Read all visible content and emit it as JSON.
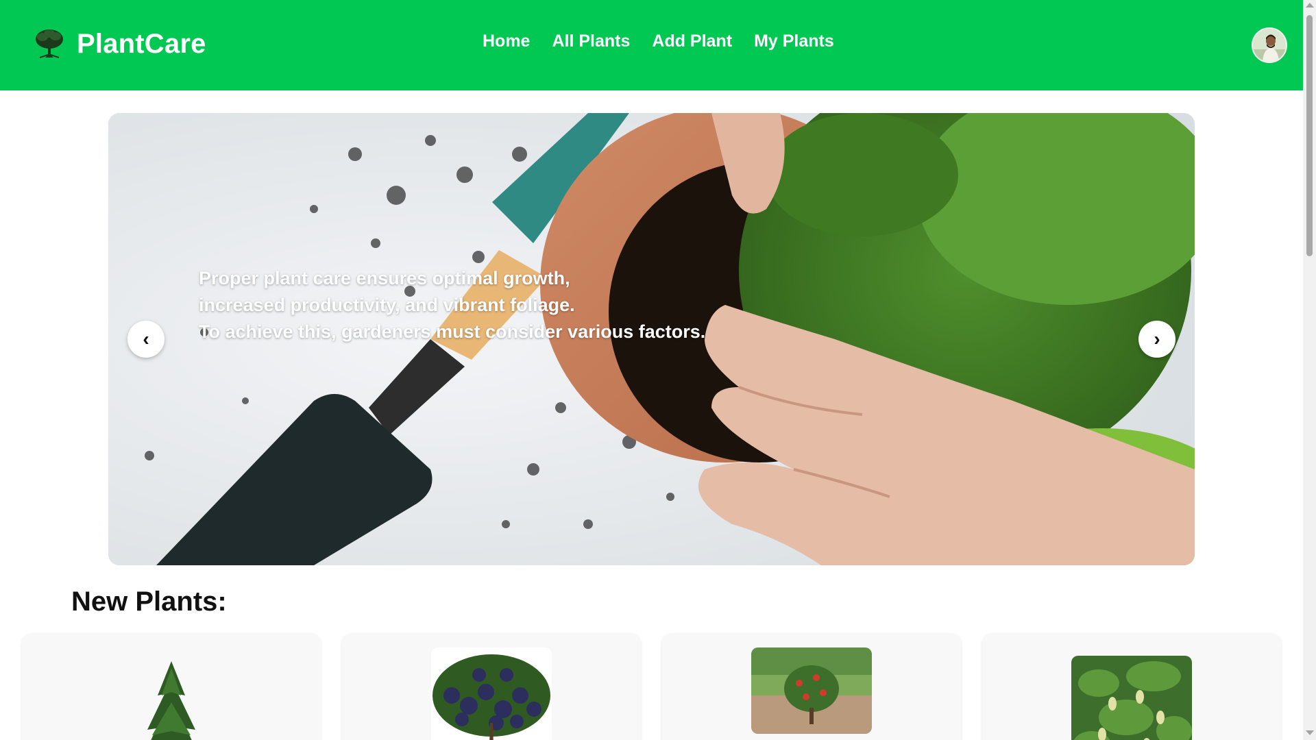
{
  "header": {
    "brand": "PlantCare",
    "brand_icon": "tree-icon",
    "nav": [
      {
        "label": "Home"
      },
      {
        "label": "All Plants"
      },
      {
        "label": "Add Plant"
      },
      {
        "label": "My Plants"
      }
    ],
    "avatar_icon": "user-avatar"
  },
  "carousel": {
    "lines": [
      "Proper plant care ensures optimal growth,",
      "increased productivity, and vibrant foliage.",
      "To achieve this, gardeners must consider various factors."
    ],
    "prev_symbol": "‹",
    "next_symbol": "›"
  },
  "section": {
    "title": "New Plants:"
  },
  "plants": [
    {
      "image_icon": "pine-tree-image"
    },
    {
      "image_icon": "grape-vine-image"
    },
    {
      "image_icon": "fruit-tree-image"
    },
    {
      "image_icon": "mango-tree-image"
    }
  ],
  "colors": {
    "brand_green": "#00c853",
    "nav_text": "#ffffff",
    "card_bg": "#f8f8f8"
  }
}
